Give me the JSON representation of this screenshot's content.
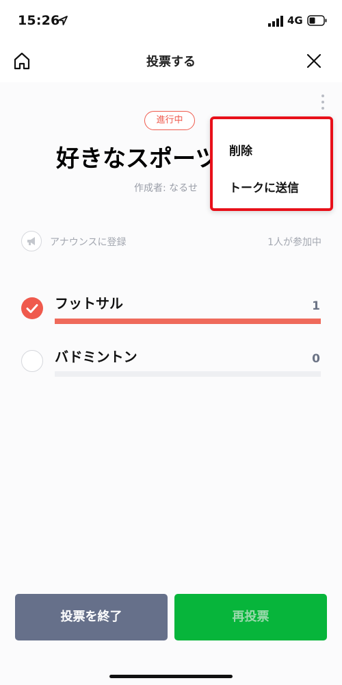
{
  "status_bar": {
    "time": "15:26",
    "network": "4G"
  },
  "header": {
    "title": "投票する"
  },
  "poll": {
    "status": "進行中",
    "question": "好きなスポーツ",
    "author": "作成者: なるせ"
  },
  "menu": {
    "delete_label": "削除",
    "share_label": "トークに送信"
  },
  "announce": {
    "label": "アナウンスに登録",
    "participants": "1人が参加中"
  },
  "options": [
    {
      "label": "フットサル",
      "count": "1",
      "share": 1.0,
      "selected": true
    },
    {
      "label": "バドミントン",
      "count": "0",
      "share": 0.0,
      "selected": false
    }
  ],
  "buttons": {
    "end_label": "投票を終了",
    "revote_label": "再投票"
  },
  "colors": {
    "accent": "#ef5a4d",
    "green": "#07b53b",
    "slate": "#66708a",
    "menu_border": "#e8101a"
  }
}
